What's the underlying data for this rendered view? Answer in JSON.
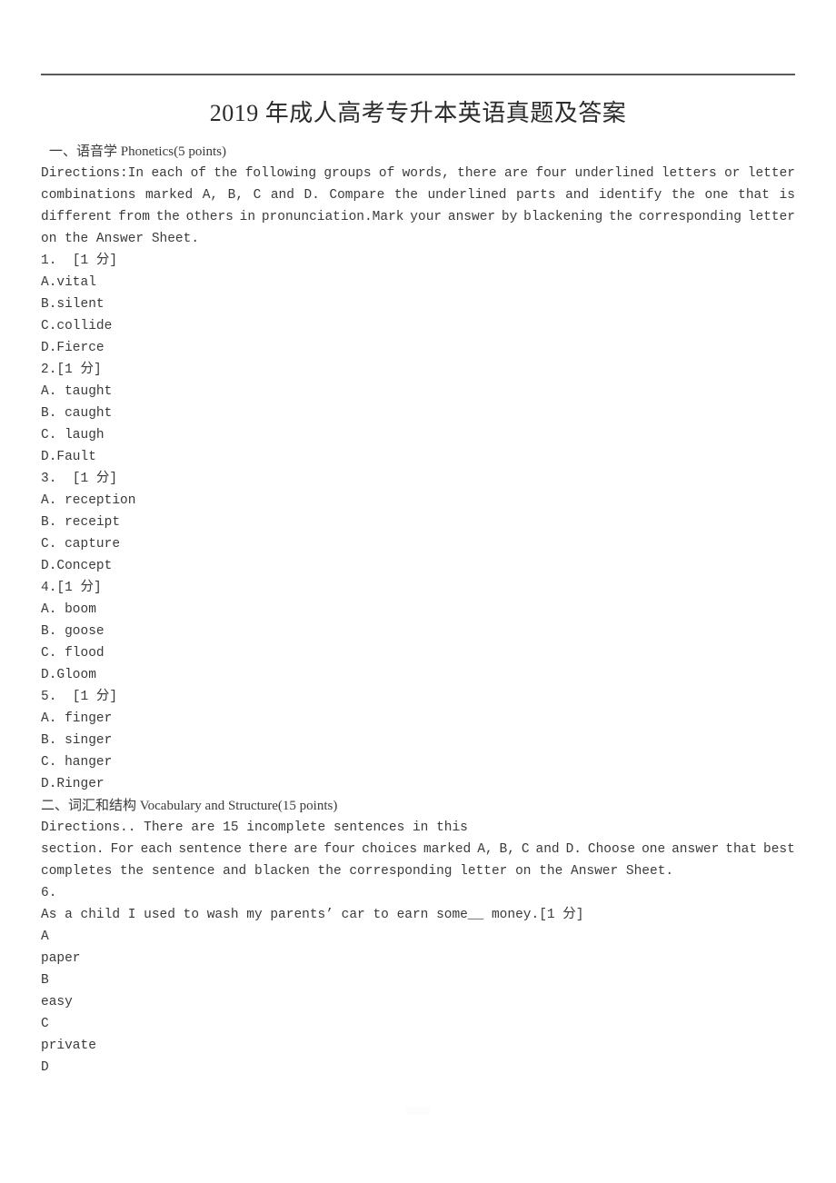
{
  "document": {
    "title": "2019 年成人高考专升本英语真题及答案"
  },
  "sections": [
    {
      "heading": "一、语音学 Phonetics(5 points)",
      "directions_lines": [
        [
          "Directions:In",
          "each",
          "of",
          "the",
          "following",
          "groups",
          "of",
          "words,",
          "there",
          "are",
          "four",
          "underlined",
          "letters",
          "or",
          "letter"
        ],
        [
          "combinations",
          "marked",
          "A,",
          "B,",
          "C",
          "and",
          "D.",
          "Compare",
          "the",
          "underlined",
          "parts",
          "and",
          "identify",
          "the",
          "one",
          "that",
          "is"
        ],
        [
          "different",
          "from",
          "the",
          "others",
          "in",
          "pronunciation.Mark",
          "your",
          "answer",
          "by",
          "blackening",
          "the",
          "corresponding",
          "letter"
        ]
      ],
      "directions_last": "on the Answer Sheet.",
      "questions": [
        {
          "number": "1.  [1 分]",
          "options": [
            "A.vital",
            "B.silent",
            "C.collide",
            "D.Fierce"
          ]
        },
        {
          "number": "2.[1 分]",
          "options": [
            "A. taught",
            "B. caught",
            "C. laugh",
            "D.Fault"
          ]
        },
        {
          "number": "3.  [1 分]",
          "options": [
            "A. reception",
            "B. receipt",
            "C. capture",
            "D.Concept"
          ]
        },
        {
          "number": "4.[1 分]",
          "options": [
            "A. boom",
            "B. goose",
            "C. flood",
            "D.Gloom"
          ]
        },
        {
          "number": "5.  [1 分]",
          "options": [
            "A. finger",
            "B. singer",
            "C. hanger",
            "D.Ringer"
          ]
        }
      ]
    },
    {
      "heading": "二、词汇和结构 Vocabulary and Structure(15 points)",
      "directions_first": "Directions.. There are 15 incomplete sentences in this",
      "directions_lines": [
        [
          "section.",
          "For",
          "each",
          "sentence",
          "there",
          "are",
          "four",
          "choices",
          "marked",
          "A,",
          "B,",
          "C",
          "and",
          "D.",
          "Choose",
          "one",
          "answer",
          "that",
          "best"
        ]
      ],
      "directions_last": "completes the sentence and blacken the corresponding letter on the Answer Sheet.",
      "questions": [
        {
          "number": "6.",
          "stem": "As a child I used to wash my parents’ car to earn some__ money.[1 分]",
          "option_letters": [
            "A",
            "B",
            "C",
            "D"
          ],
          "option_texts": [
            "paper",
            "easy",
            "private"
          ]
        }
      ]
    }
  ]
}
